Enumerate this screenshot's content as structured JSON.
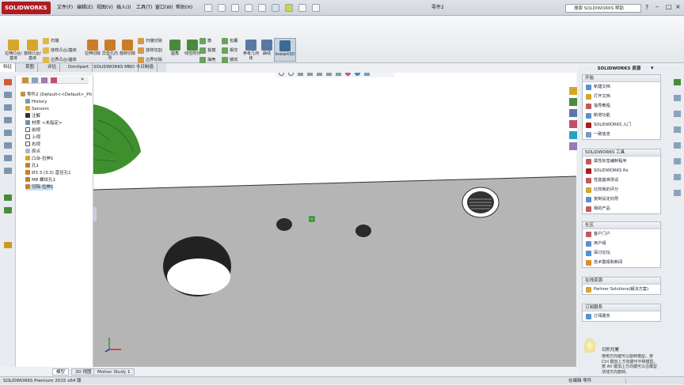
{
  "app": {
    "logo_text": "SOLIDWORKS",
    "document_title": "零件2",
    "search_placeholder": "搜索 SOLIDWORKS 帮助"
  },
  "menu": [
    "文件(F)",
    "编辑(E)",
    "视图(V)",
    "插入(I)",
    "工具(T)",
    "窗口(W)",
    "帮助(H)"
  ],
  "ribbon": {
    "tools": [
      {
        "label": "拉伸凸台/基体",
        "color": "#d6a52b"
      },
      {
        "label": "旋转凸台/基体",
        "color": "#d6a52b"
      },
      {
        "label": "拉伸切除",
        "color": "#c97d28"
      },
      {
        "label": "异型孔向导",
        "color": "#c97d28"
      },
      {
        "label": "旋转切除",
        "color": "#c97d28"
      },
      {
        "label": "圆角",
        "color": "#4a8a3c"
      },
      {
        "label": "线性阵列",
        "color": "#4a8a3c"
      },
      {
        "label": "参考几何体",
        "color": "#5978a6"
      },
      {
        "label": "曲线",
        "color": "#5978a6"
      },
      {
        "label": "Instant3D",
        "color": "#3d6b94"
      }
    ],
    "small": [
      "扫描",
      "放样凸台/基体",
      "边界凸台/基体",
      "扫描切除",
      "放样切割",
      "边界切除",
      "筋",
      "拔模",
      "抽壳",
      "包覆",
      "相交",
      "镜向"
    ]
  },
  "command_tabs": [
    "特征",
    "草图",
    "评估",
    "DimXpert",
    "SOLIDWORKS MBD",
    "今日制造"
  ],
  "tree": {
    "root": "零件2  (Default<<Default>_Ph",
    "items": [
      "History",
      "Sensors",
      "注解",
      "材质 <未指定>",
      "前视",
      "上视",
      "右视",
      "原点",
      "凸台-拉伸1",
      "孔1",
      "Ø3.3 (3.3) 直径孔1",
      "M8 螺纹孔1",
      "切除-拉伸1"
    ]
  },
  "resources": {
    "title": "SOLIDWORKS 资源",
    "groups": [
      {
        "title": "开始",
        "items": [
          "新建文档",
          "打开文档",
          "指导教程",
          "新增功能",
          "SOLIDWORKS 入门",
          "一致信息"
        ]
      },
      {
        "title": "SOLIDWORKS 工具",
        "items": [
          "属性标签编制程序",
          "SOLIDWORKS Rx",
          "性能基准测试",
          "比较我的评分",
          "复制设定向导",
          "我的产品"
        ]
      },
      {
        "title": "社区",
        "items": [
          "客户门户",
          "用户组",
          "探讨论坛",
          "技术警报和新闻"
        ]
      },
      {
        "title": "在线资源",
        "items": [
          "Partner Solutions(解决方案)"
        ]
      },
      {
        "title": "订阅服务",
        "items": [
          "订阅服务"
        ]
      }
    ],
    "tip_title": "日积月累",
    "tip_text": "使用方向键可以旋转模型。按 Ctrl 键加上方向键可平移模型。按 Alt 键加上方向键可以沿模型法线方向旋转。"
  },
  "bottom_tabs": [
    "模型",
    "3D 视图",
    "Motion Study 1"
  ],
  "status": {
    "left": "SOLIDWORKS Premium 2015 x64 版",
    "right": "在编辑 零件"
  }
}
